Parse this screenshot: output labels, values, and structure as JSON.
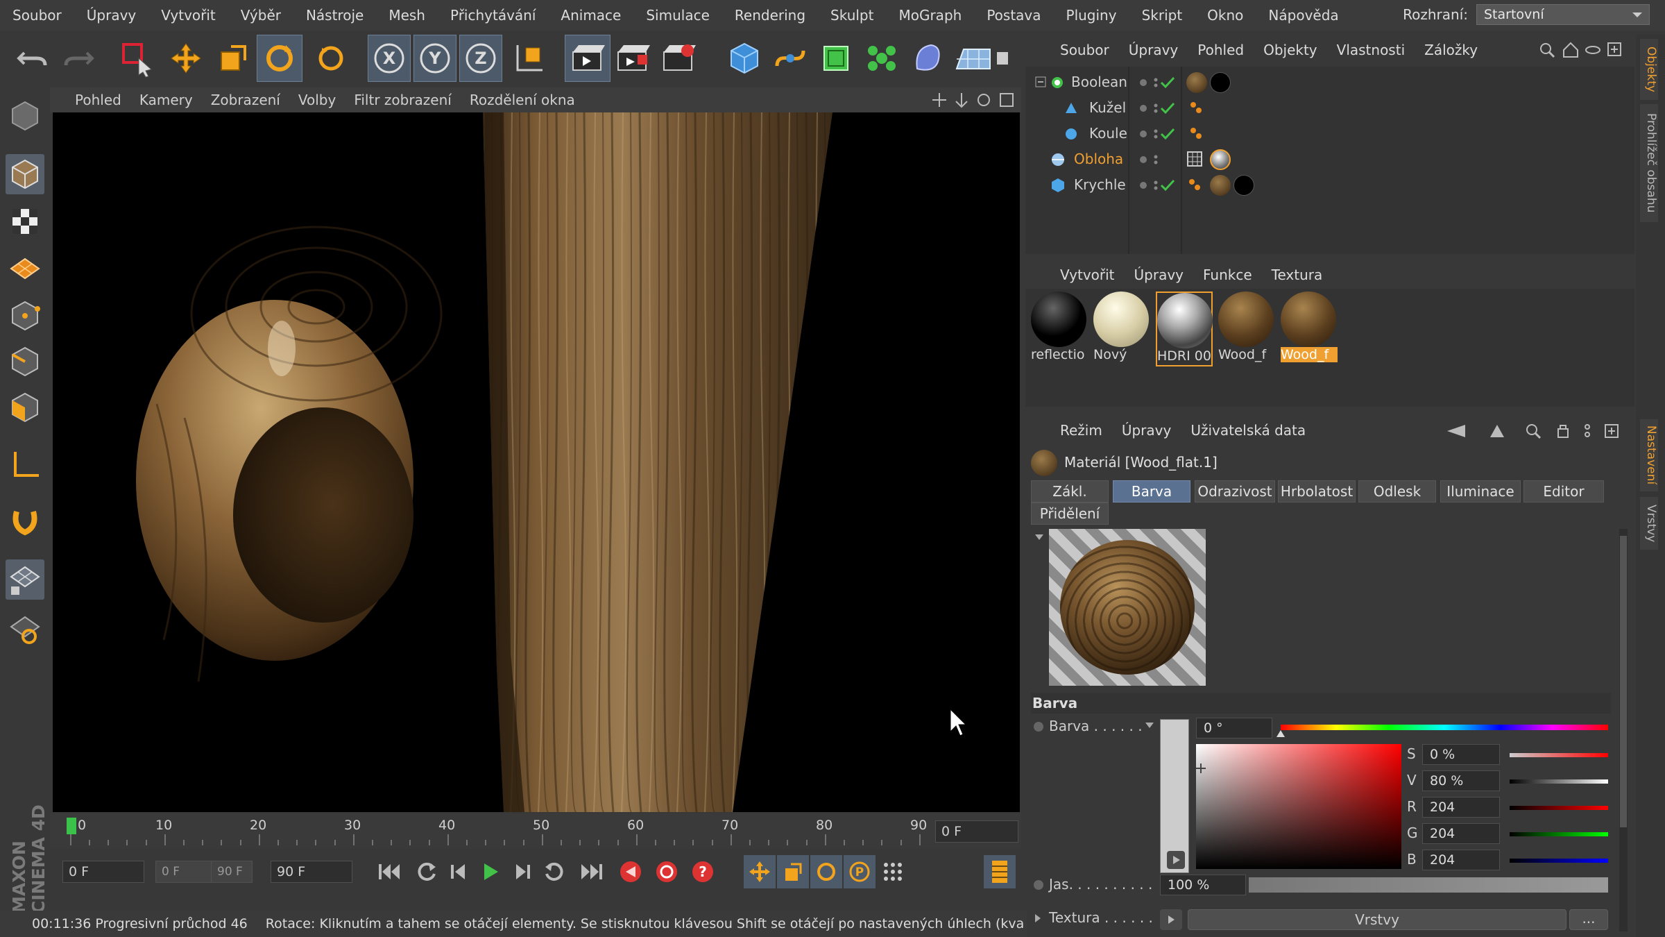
{
  "menubar": {
    "items": [
      "Soubor",
      "Úpravy",
      "Vytvořit",
      "Výběr",
      "Nástroje",
      "Mesh",
      "Přichytávání",
      "Animace",
      "Simulace",
      "Rendering",
      "Skulpt",
      "MoGraph",
      "Postava",
      "Pluginy",
      "Skript",
      "Okno",
      "Nápověda"
    ],
    "interface_label": "Rozhraní:",
    "interface_value": "Startovní"
  },
  "viewport": {
    "menu": [
      "Pohled",
      "Kamery",
      "Zobrazení",
      "Volby",
      "Filtr zobrazení",
      "Rozdělení okna"
    ]
  },
  "timeline": {
    "ticks": [
      "0",
      "10",
      "20",
      "30",
      "40",
      "50",
      "60",
      "70",
      "80",
      "90"
    ],
    "current_frame": "0 F",
    "start_field": "0 F",
    "range_start": "0 F",
    "range_end": "90 F",
    "end_field": "90 F"
  },
  "status": {
    "text": "00:11:36 Progresivní průchod 46",
    "hint": "Rotace: Kliknutím a tahem se otáčejí elementy. Se stisknutou klávesou Shift se otáčejí po nastavených úhlech (kva"
  },
  "objects": {
    "menu": [
      "Soubor",
      "Úpravy",
      "Pohled",
      "Objekty",
      "Vlastnosti",
      "Záložky"
    ],
    "items": [
      {
        "name": "Boolean"
      },
      {
        "name": "Kužel"
      },
      {
        "name": "Koule"
      },
      {
        "name": "Obloha"
      },
      {
        "name": "Krychle"
      }
    ]
  },
  "materials": {
    "menu": [
      "Vytvořit",
      "Úpravy",
      "Funkce",
      "Textura"
    ],
    "items": [
      {
        "label": "reflectio"
      },
      {
        "label": "Nový"
      },
      {
        "label": "HDRI 00"
      },
      {
        "label": "Wood_f"
      },
      {
        "label": "Wood_f"
      }
    ]
  },
  "attributes": {
    "menu": [
      "Režim",
      "Úpravy",
      "Uživatelská data"
    ],
    "title": "Materiál [Wood_flat.1]",
    "tabs": [
      "Zákl.",
      "Barva",
      "Odrazivost",
      "Hrbolatost",
      "Odlesk",
      "Iluminace",
      "Editor"
    ],
    "tab2": "Přidělení",
    "section": "Barva",
    "color_label": "Barva . . . . . .",
    "hue": "0 °",
    "s_label": "S",
    "s_value": "0 %",
    "v_label": "V",
    "v_value": "80 %",
    "r_label": "R",
    "r_value": "204",
    "g_label": "G",
    "g_value": "204",
    "b_label": "B",
    "b_value": "204",
    "brightness_label": "Jas. . . . . . . . . .",
    "brightness_value": "100 %",
    "texture_label": "Textura . . . . . .",
    "layers_button": "Vrstvy",
    "more_button": "..."
  },
  "side_tabs": {
    "top": [
      "Objekty",
      "Prohlížeč obsahu"
    ],
    "bottom": [
      "Nastavení",
      "Vrstvy"
    ]
  },
  "branding": "MAXON CINEMA 4D"
}
